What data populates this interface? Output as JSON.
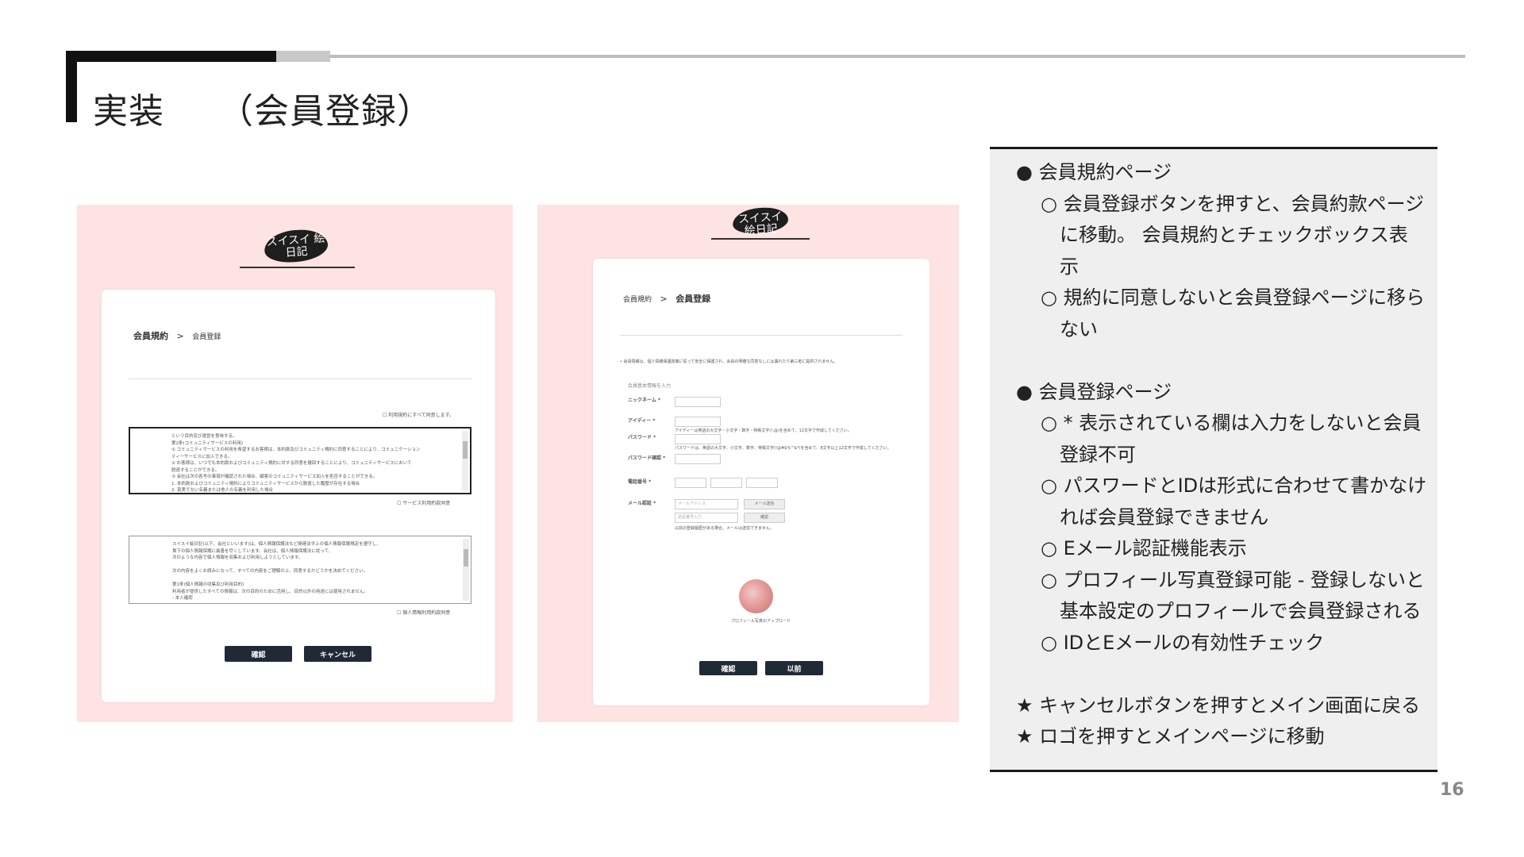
{
  "slide": {
    "title": "実装　　（会員登録）",
    "page_number": "16"
  },
  "left_screen": {
    "logo_text": "スイスイ 絵日記",
    "breadcrumb_step1": "会員規約",
    "breadcrumb_sep": ">",
    "breadcrumb_step2": "会員登録",
    "agree_all": "☐ 利用規約にすべて同意します。",
    "terms1_lines": [
      "という目的及び運営を意味する。",
      "第2条(コミュニティサービスの利用)",
      "① コミュニティサービスの利用を希望するお客様は、本約款及びコミュニティ規約に同意することにより、コミュニケーション",
      "ティーサービスに加入できる。",
      "② お客様は、いつでも本約款およびコミュニティ規約に対する同意を撤回することにより、コミュニティサービスにおいて",
      "脱退することができる。",
      "③ 会社は次の各号の事項が確認された場合、顧客のコミュニティサービス加入を拒否することができる。",
      "1. 本約款およびコミュニティ規約によりコミュニティサービスから脱退した履歴が存在する場合",
      "2. 真実でない名義または他人の名義を利用した場合"
    ],
    "agree_service": "☐ サービス利用約款同意",
    "terms2_lines": [
      "スイスイ絵日記(以下、会社といいます)は、個人情報保護法など関連法令上の個人情報保護規定を遵守し、",
      "貴下の個人情報保護に最善を尽くしています。会社は、個人情報保護法に従って、",
      "次のような内容で個人情報を収集および利用しようとしています。",
      "",
      "次の内容をよくお読みになって、すべての内容をご理解の上、同意するかどうかを決めてください。",
      "",
      "第1条(個人情報の収集及び利用目的)",
      "利用者が提供したすべての情報は、次の目的のために活用し、目的以外の用途には使用されません。",
      "- 本人確認"
    ],
    "agree_privacy": "☐ 個人情報利用約款同意",
    "confirm_button": "確認",
    "cancel_button": "キャンセル"
  },
  "right_screen": {
    "logo_text": "スイスイ 絵日記",
    "breadcrumb_step1": "会員規約",
    "breadcrumb_sep": ">",
    "breadcrumb_step2": "会員登録",
    "notice": "• 会員情報は、個人情報保護政策に従って安全に保護され、会員の明確な同意なしには漏れたり第三者に提供されません。",
    "section_caption": "会員基本情報を入力",
    "nickname_label": "ニックネーム *",
    "id_label": "アイディー *",
    "id_hint": "アイディーは英語の大文字・小文字・数字・特殊文字(!,@)を含めて、12文字で作成してください。",
    "password_label": "パスワード *",
    "password_hint": "パスワードは、英語の大文字、小文字、数字、特殊文字(!@#$%^&*)を含めて、8文字以上12文字で作成してください。",
    "password_confirm_label": "パスワード確認 *",
    "phone_label": "電話番号 *",
    "email_label": "メール認証 *",
    "email_placeholder": "メールアドレス",
    "email_send_button": "メール送信",
    "code_placeholder": "認証番号入力",
    "code_confirm_button": "確認",
    "email_hint": "以前の登録履歴がある場合、メールは送信できません。",
    "avatar_caption": "プロフィール写真のアップロード",
    "confirm_button": "確認",
    "back_button": "以前"
  },
  "notes": {
    "lines": [
      {
        "level": 1,
        "text": "● 会員規約ページ"
      },
      {
        "level": 2,
        "text": "○ 会員登録ボタンを押すと、会員約款ページ"
      },
      {
        "level": 2,
        "text": "　に移動。 会員規約とチェックボックス表"
      },
      {
        "level": 2,
        "text": "　示"
      },
      {
        "level": 2,
        "text": "○ 規約に同意しないと会員登録ページに移ら"
      },
      {
        "level": 2,
        "text": "　ない"
      },
      {
        "level": 1,
        "text": ""
      },
      {
        "level": 1,
        "text": "● 会員登録ページ"
      },
      {
        "level": 2,
        "text": "○ * 表示されている欄は入力をしないと会員"
      },
      {
        "level": 2,
        "text": "　登録不可"
      },
      {
        "level": 2,
        "text": "○ パスワードとIDは形式に合わせて書かなけ"
      },
      {
        "level": 2,
        "text": "　れば会員登録できません"
      },
      {
        "level": 2,
        "text": "○ Eメール認証機能表示"
      },
      {
        "level": 2,
        "text": "○ プロフィール写真登録可能 - 登録しないと"
      },
      {
        "level": 2,
        "text": "　基本設定のプロフィールで会員登録される"
      },
      {
        "level": 2,
        "text": "○ IDとEメールの有効性チェック"
      },
      {
        "level": 1,
        "text": ""
      },
      {
        "level": 0,
        "text": "★ キャンセルボタンを押すとメイン画面に戻る"
      },
      {
        "level": 0,
        "text": "★ ロゴを押すとメインページに移動"
      }
    ]
  }
}
